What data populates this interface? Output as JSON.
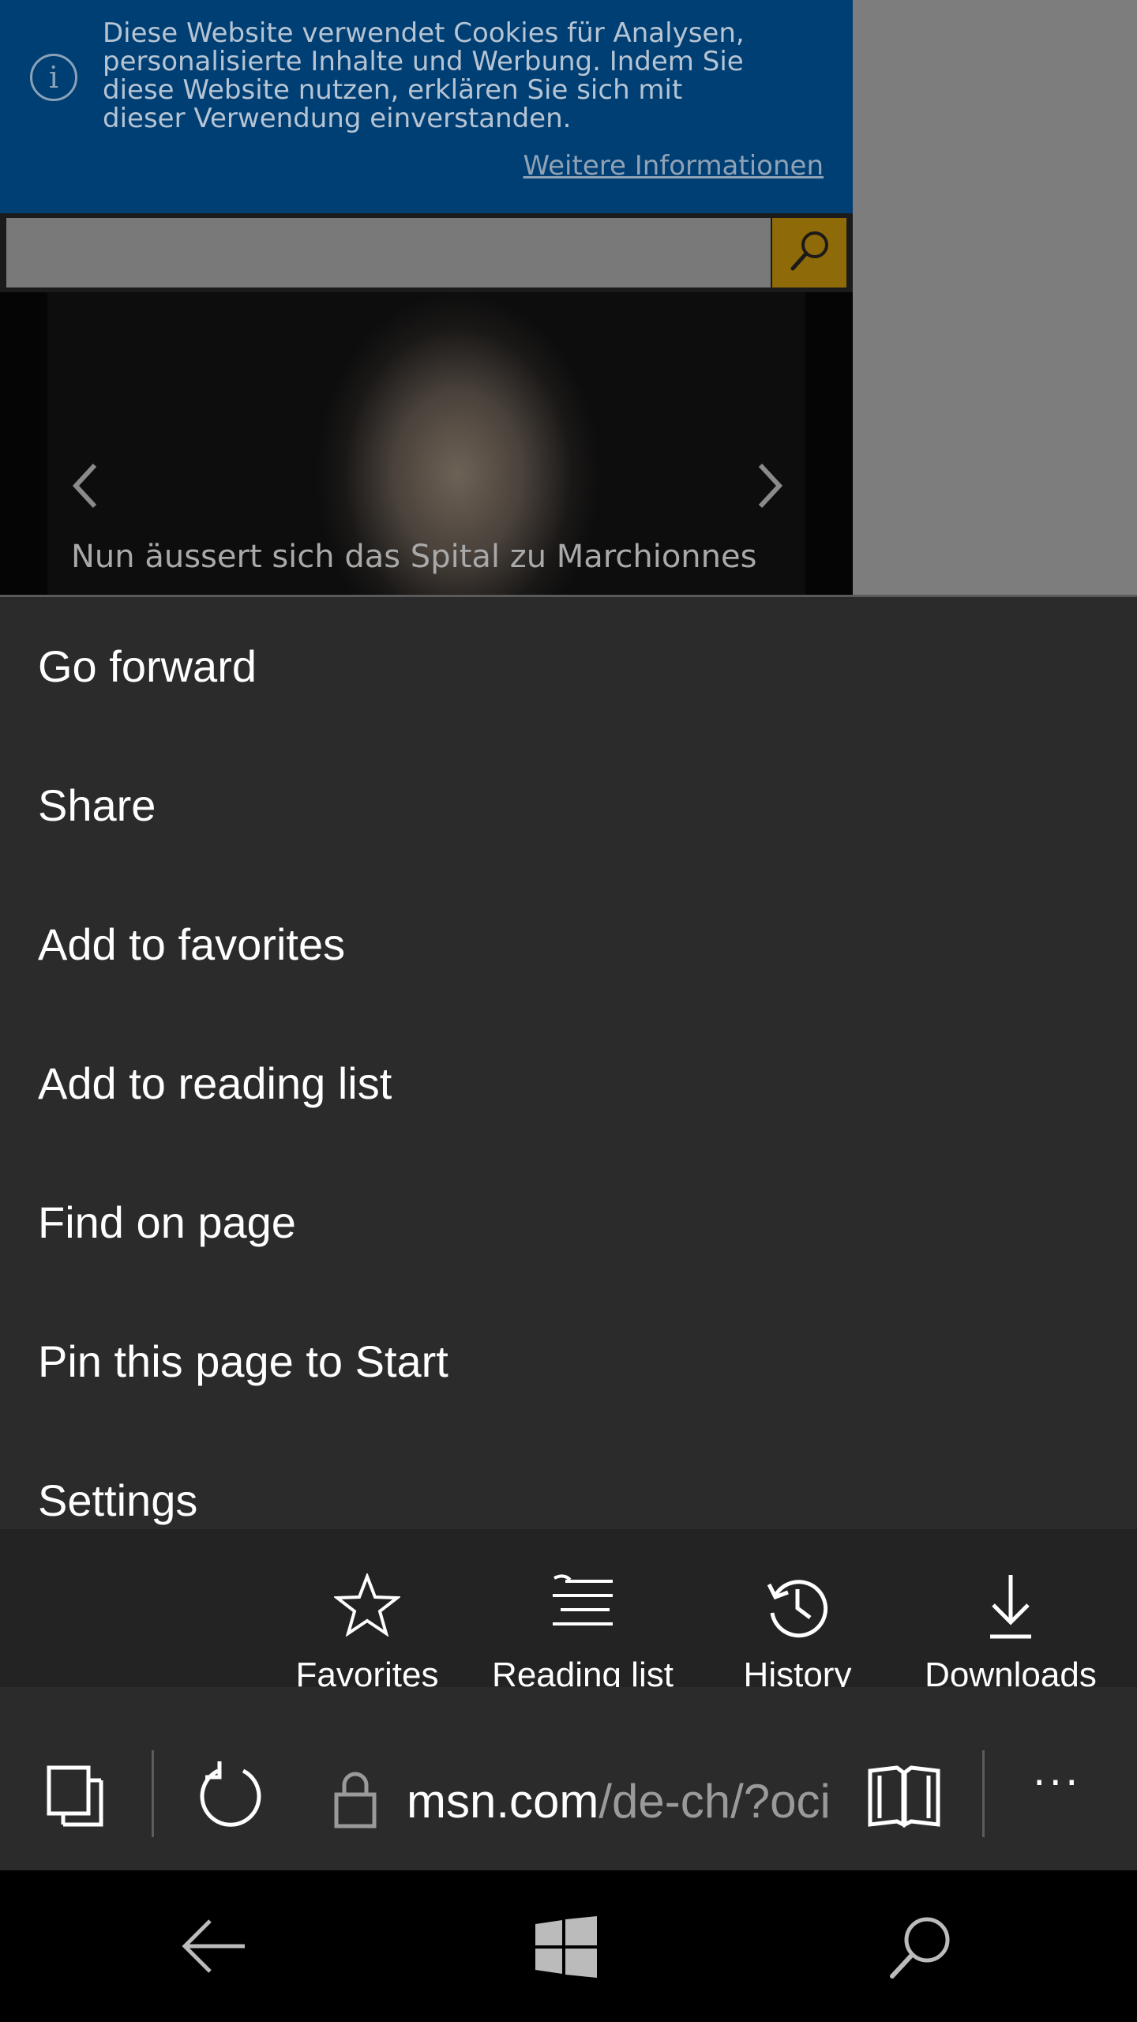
{
  "page": {
    "cookie_banner": {
      "message": "Diese Website verwendet Cookies für Analysen,\npersonalisierte Inhalte und Werbung. Indem Sie\ndiese Website nutzen, erklären Sie sich mit\ndieser Verwendung einverstanden.",
      "more_link": "Weitere Informationen",
      "background": "#003f74"
    },
    "search": {
      "placeholder": "",
      "button_color": "#8f6a09"
    },
    "hero": {
      "caption": "Nun äussert sich das Spital zu Marchionnes"
    }
  },
  "menu": {
    "items": [
      {
        "label": "Go forward"
      },
      {
        "label": "Share"
      },
      {
        "label": "Add to favorites"
      },
      {
        "label": "Add to reading list"
      },
      {
        "label": "Find on page"
      },
      {
        "label": "Pin this page to Start"
      },
      {
        "label": "Settings"
      }
    ]
  },
  "hub": {
    "items": [
      {
        "label": "Favorites",
        "icon": "star-icon"
      },
      {
        "label": "Reading list",
        "icon": "reading-list-icon"
      },
      {
        "label": "History",
        "icon": "history-icon"
      },
      {
        "label": "Downloads",
        "icon": "download-icon"
      }
    ]
  },
  "address_bar": {
    "domain": "msn.com",
    "path": "/de-ch/?oci",
    "more_label": "···"
  },
  "colors": {
    "menu_bg": "#2b2b2b",
    "hub_bg": "#232323",
    "accent": "#8f6a09"
  }
}
